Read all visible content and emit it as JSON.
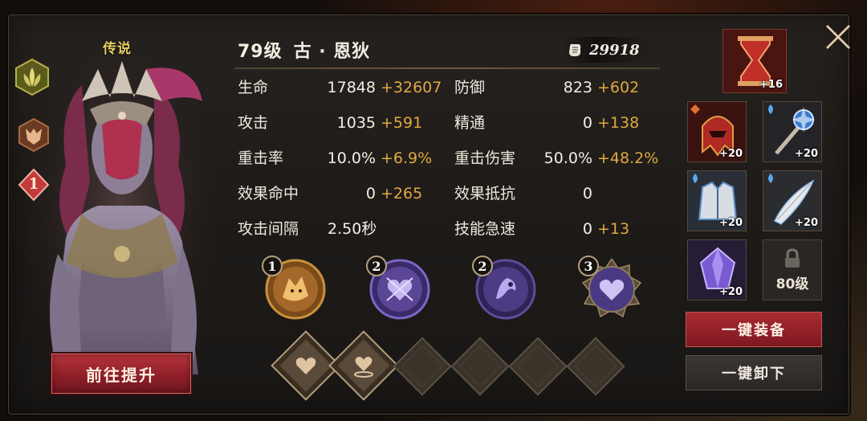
{
  "hero": {
    "rarity": "传说",
    "level": "79级",
    "name": "古 · 恩狄",
    "power": "29918",
    "rank": "1",
    "upgrade_label": "前往提升"
  },
  "stats": [
    {
      "label": "生命",
      "base": "17848",
      "bonus": "+32607"
    },
    {
      "label": "防御",
      "base": "823",
      "bonus": "+602"
    },
    {
      "label": "攻击",
      "base": "1035",
      "bonus": "+591"
    },
    {
      "label": "精通",
      "base": "0",
      "bonus": "+138"
    },
    {
      "label": "重击率",
      "base": "10.0%",
      "bonus": "+6.9%"
    },
    {
      "label": "重击伤害",
      "base": "50.0%",
      "bonus": "+48.2%"
    },
    {
      "label": "效果命中",
      "base": "0",
      "bonus": "+265"
    },
    {
      "label": "效果抵抗",
      "base": "0",
      "bonus": ""
    },
    {
      "label": "攻击间隔",
      "base": "2.50秒",
      "bonus": ""
    },
    {
      "label": "技能急速",
      "base": "0",
      "bonus": "+13"
    }
  ],
  "skills": [
    {
      "level": "1",
      "icon": "fox-skill-icon"
    },
    {
      "level": "2",
      "icon": "heart-shield-skill-icon"
    },
    {
      "level": "2",
      "icon": "spirit-skill-icon"
    },
    {
      "level": "3",
      "icon": "heart-aura-skill-icon"
    }
  ],
  "rune_slots": [
    {
      "icon": "heart-icon",
      "filled": true
    },
    {
      "icon": "heart-pedestal-icon",
      "filled": true
    },
    {
      "icon": "empty-slot",
      "filled": false
    },
    {
      "icon": "empty-slot",
      "filled": false
    },
    {
      "icon": "empty-slot",
      "filled": false
    },
    {
      "icon": "empty-slot",
      "filled": false
    }
  ],
  "equipment": {
    "relic": {
      "name": "hourglass-relic-icon",
      "plus": "+16"
    },
    "helmet": {
      "name": "helmet-icon",
      "plus": "+20"
    },
    "staff": {
      "name": "staff-icon",
      "plus": "+20"
    },
    "armor": {
      "name": "armor-icon",
      "plus": "+20"
    },
    "wing": {
      "name": "feather-blade-icon",
      "plus": "+20"
    },
    "crystal": {
      "name": "crystal-icon",
      "plus": "+20"
    },
    "locked": {
      "name": "lock-icon",
      "requirement": "80级"
    }
  },
  "actions": {
    "equip_all": "一键装备",
    "unequip_all": "一键卸下"
  },
  "colors": {
    "accent_gold": "#e0a940",
    "legend_yellow": "#e7cc62",
    "button_red": "#a82a33"
  }
}
